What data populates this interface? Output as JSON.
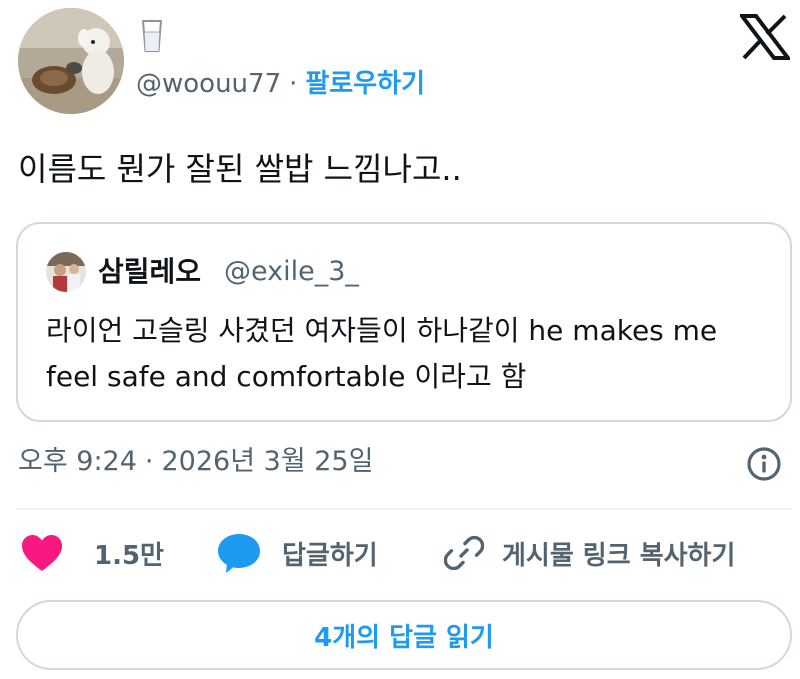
{
  "author": {
    "handle": "@woouu77",
    "separator": "·",
    "follow_label": "팔로우하기",
    "avatar_icon": "puppy-photo-avatar",
    "badge_icon": "glass-of-milk-icon"
  },
  "brand": {
    "logo_icon": "x-logo-icon"
  },
  "tweet": {
    "text": "이름도 뭔가 잘된 쌀밥 느낌나고.."
  },
  "quote": {
    "name": "삼릴레오",
    "handle": "@exile_3_",
    "text": "라이언 고슬링 사겼던 여자들이 하나같이 he makes me feel safe and comfortable 이라고 함",
    "avatar_icon": "user-photo-avatar"
  },
  "meta": {
    "time": "오후 9:24",
    "separator": "·",
    "date": "2026년 3월 25일",
    "info_icon": "info-icon"
  },
  "actions": {
    "like_count": "1.5만",
    "reply_label": "답글하기",
    "copy_link_label": "게시물 링크 복사하기",
    "like_icon": "heart-icon",
    "reply_icon": "speech-bubble-icon",
    "link_icon": "link-icon"
  },
  "read_replies_label": "4개의 답글 읽기",
  "colors": {
    "accent": "#1d9bf0",
    "text_primary": "#0f1419",
    "text_secondary": "#536471",
    "heart": "#f91880",
    "border": "#cfd9de"
  }
}
